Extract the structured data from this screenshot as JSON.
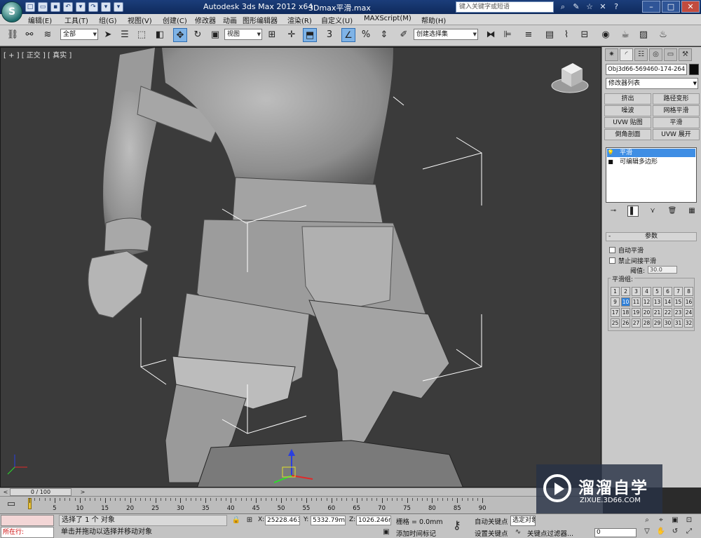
{
  "titlebar": {
    "app_title": "Autodesk 3ds Max  2012 x64",
    "file_title": "3Dmax平滑.max",
    "search_placeholder": "键入关键字或短语"
  },
  "menu": [
    "编辑(E)",
    "工具(T)",
    "组(G)",
    "视图(V)",
    "创建(C)",
    "修改器",
    "动画",
    "图形编辑器",
    "渲染(R)",
    "自定义(U)",
    "MAXScript(M)",
    "帮助(H)"
  ],
  "toolbar": {
    "selection_filter": "全部",
    "ref_coord": "视图",
    "named_selection": "创建选择集",
    "snap_angle": "3",
    "snap_percent": "%"
  },
  "viewport": {
    "label": "[ + ] [ 正交 ] [ 真实 ]"
  },
  "command_panel": {
    "object_name": "Obj3d66-569460-174-264",
    "modifier_list": "修改器列表",
    "modifier_buttons": [
      "挤出",
      "路径变形",
      "噪波",
      "网格平滑",
      "UVW 贴图",
      "平滑",
      "倒角剖面",
      "UVW 展开"
    ],
    "stack": [
      {
        "label": "平滑",
        "icon": "bulb-icon",
        "selected": true
      },
      {
        "label": "可编辑多边形",
        "icon": "square-icon",
        "selected": false
      }
    ],
    "rollout_title": "参数",
    "auto_smooth": "自动平滑",
    "prevent_indirect": "禁止间接平滑",
    "threshold_label": "阈值:",
    "threshold_value": "30.0",
    "groups_title": "平滑组:",
    "smoothing_groups": [
      "1",
      "2",
      "3",
      "4",
      "5",
      "6",
      "7",
      "8",
      "9",
      "10",
      "11",
      "12",
      "13",
      "14",
      "15",
      "16",
      "17",
      "18",
      "19",
      "20",
      "21",
      "22",
      "23",
      "24",
      "25",
      "26",
      "27",
      "28",
      "29",
      "30",
      "31",
      "32"
    ],
    "smoothing_group_active": "10"
  },
  "timeline": {
    "frame_display": "0 / 100",
    "ticks": [
      "5",
      "10",
      "15",
      "20",
      "25",
      "30",
      "35",
      "40",
      "45",
      "50",
      "55",
      "60",
      "65",
      "70",
      "75",
      "80",
      "85",
      "90"
    ]
  },
  "status": {
    "maxscript_text": "所在行:",
    "selection_status": "选择了 1 个 对象",
    "prompt": "单击并拖动以选择并移动对象",
    "x_label": "X:",
    "x_value": "25228.463",
    "y_label": "Y:",
    "y_value": "5332.79m",
    "z_label": "Z:",
    "z_value": "1026.246m",
    "grid": "栅格 = 0.0mm",
    "add_time_tag": "添加时间标记",
    "auto_key": "自动关键点",
    "selected_dropdown": "选定对象",
    "set_key": "设置关键点",
    "key_filters": "关键点过滤器...",
    "current_frame": "0"
  },
  "watermark": {
    "title": "溜溜自学",
    "url": "ZIXUE.3D66.COM"
  }
}
